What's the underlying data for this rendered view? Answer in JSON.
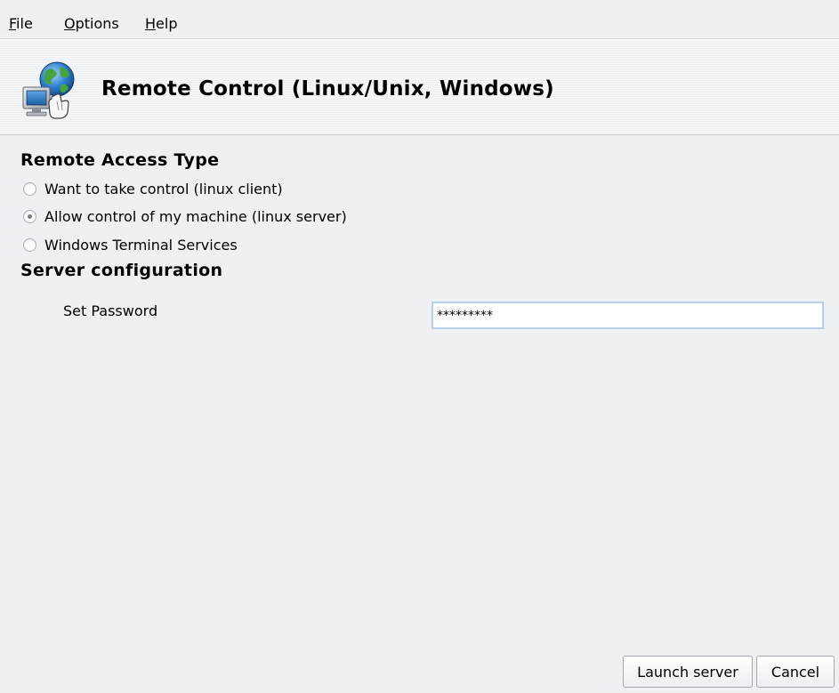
{
  "menu": {
    "items": [
      {
        "label": "File",
        "mnemonic": "F",
        "rest": "ile"
      },
      {
        "label": "Options",
        "mnemonic": "O",
        "rest": "ptions"
      },
      {
        "label": "Help",
        "mnemonic": "H",
        "rest": "elp"
      }
    ]
  },
  "header": {
    "icon": "remote-control-globe-computer-icon",
    "title": "Remote Control (Linux/Unix, Windows)"
  },
  "access_type": {
    "title": "Remote Access Type",
    "options": [
      {
        "label": "Want to take control (linux client)",
        "checked": false
      },
      {
        "label": "Allow control of my machine (linux server)",
        "checked": true
      },
      {
        "label": "Windows Terminal Services",
        "checked": false
      }
    ]
  },
  "server_config": {
    "title": "Server configuration",
    "password_label": "Set Password",
    "password_value": "*********"
  },
  "buttons": {
    "launch": "Launch server",
    "cancel": "Cancel"
  },
  "colors": {
    "background": "#eef0f4",
    "input_border": "#b7cfe8"
  }
}
